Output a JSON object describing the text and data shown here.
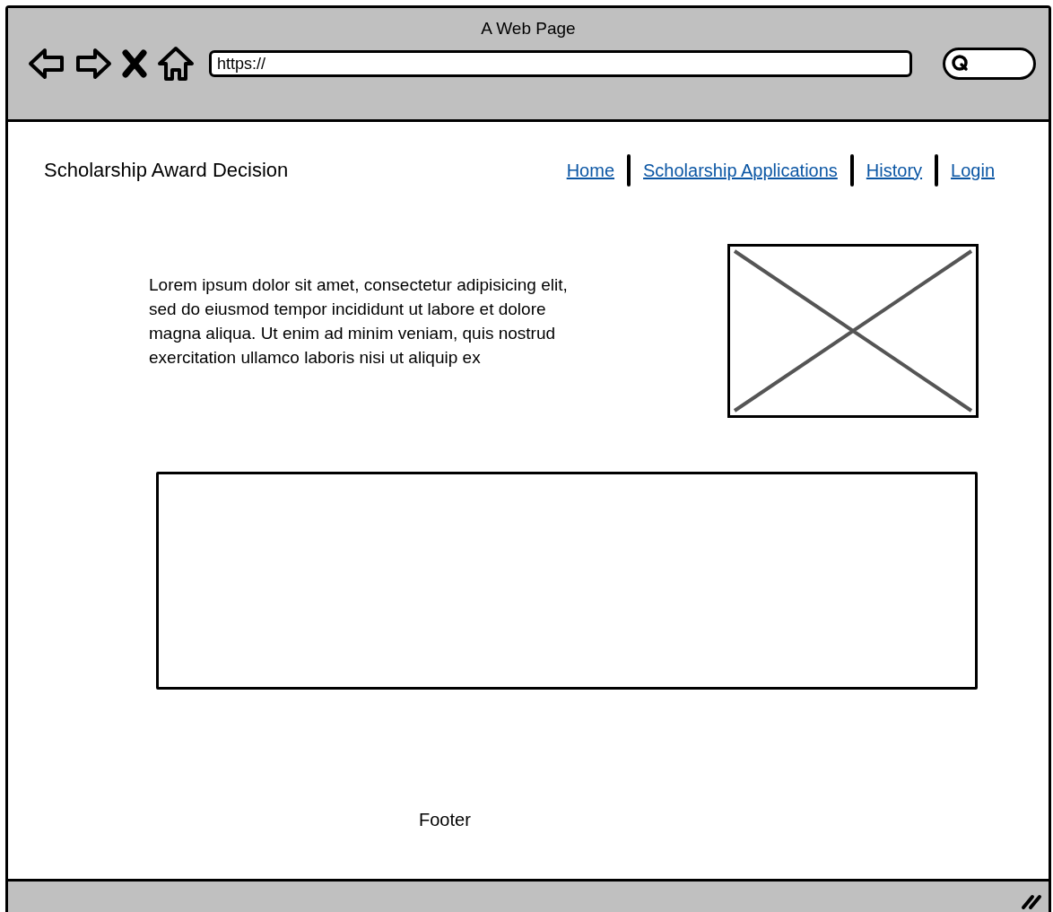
{
  "window": {
    "title": "A Web Page"
  },
  "browser": {
    "url": "https://"
  },
  "header": {
    "title": "Scholarship Award Decision"
  },
  "nav": [
    {
      "label": "Home"
    },
    {
      "label": "Scholarship Applications"
    },
    {
      "label": "History"
    },
    {
      "label": "Login"
    }
  ],
  "content": {
    "paragraph": "Lorem ipsum dolor sit amet, consectetur adipisicing elit, sed do eiusmod tempor incididunt ut labore et dolore magna aliqua. Ut enim ad minim veniam, quis nostrud exercitation ullamco laboris nisi ut aliquip ex"
  },
  "footer": {
    "text": "Footer"
  }
}
